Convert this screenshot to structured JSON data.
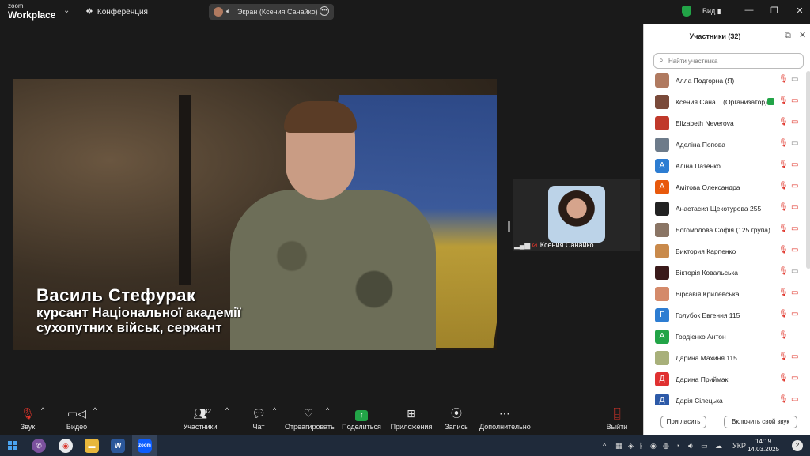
{
  "titlebar": {
    "logo_line1": "zoom",
    "logo_line2": "Workplace",
    "meeting_label": "Конференция",
    "share_indicator": "Экран (Ксения Санайко)",
    "view_label": "Вид"
  },
  "shared_screen": {
    "caption_name": "Василь Стефурак",
    "caption_line1": "курсант Національної академії",
    "caption_line2": "сухопутних військ, сержант"
  },
  "self_view": {
    "name": "Ксения Санайко"
  },
  "toolbar": {
    "audio": "Звук",
    "video": "Видео",
    "participants": "Участники",
    "participants_count": "32",
    "chat": "Чат",
    "react": "Отреагировать",
    "share": "Поделиться",
    "apps": "Приложения",
    "record": "Запись",
    "more": "Дополнительно",
    "leave": "Выйти"
  },
  "participants_panel": {
    "title": "Участники (32)",
    "search_placeholder": "Найти участника",
    "invite_button": "Пригласить",
    "unmute_button": "Включить свой звук",
    "participants": [
      {
        "name": "Алла Подгорна (Я)",
        "avatar": "",
        "avatar_color": "#b07a60",
        "cam": "on"
      },
      {
        "name": "Ксения Сана... (Организатор)",
        "avatar": "",
        "avatar_color": "#7a4a3a",
        "cam": "off",
        "host": true
      },
      {
        "name": "Elizabeth Neverova",
        "avatar": "",
        "avatar_color": "#c0392b",
        "cam": "off"
      },
      {
        "name": "Аделіна Попова",
        "avatar": "",
        "avatar_color": "#6d7b8a",
        "cam": "on"
      },
      {
        "name": "Аліна Пазенко",
        "avatar": "А",
        "avatar_color": "#2d7dd2",
        "cam": "off"
      },
      {
        "name": "Амітова Олександра",
        "avatar": "А",
        "avatar_color": "#e8590c",
        "cam": "off"
      },
      {
        "name": "Анастасия Щекотурова 255",
        "avatar": "",
        "avatar_color": "#222222",
        "cam": "off"
      },
      {
        "name": "Богомолова Софія (125 група)",
        "avatar": "",
        "avatar_color": "#8a7565",
        "cam": "off"
      },
      {
        "name": "Виктория Карпенко",
        "avatar": "",
        "avatar_color": "#c98a4b",
        "cam": "off"
      },
      {
        "name": "Вікторія Ковальська",
        "avatar": "",
        "avatar_color": "#3a1a1a",
        "cam": "on"
      },
      {
        "name": "Вірсавія Крилевська",
        "avatar": "",
        "avatar_color": "#d48a6a",
        "cam": "off"
      },
      {
        "name": "Голубок Евгения 115",
        "avatar": "Г",
        "avatar_color": "#2d7dd2",
        "cam": "off"
      },
      {
        "name": "Гордієнко Антон",
        "avatar": "А",
        "avatar_color": "#22a447",
        "cam": "none"
      },
      {
        "name": "Дарина Махиня 115",
        "avatar": "",
        "avatar_color": "#a8b07a",
        "cam": "off"
      },
      {
        "name": "Дарина Приймак",
        "avatar": "Д",
        "avatar_color": "#e03131",
        "cam": "off"
      },
      {
        "name": "Дарія Сілецька",
        "avatar": "Д",
        "avatar_color": "#2d5aa8",
        "cam": "off"
      }
    ]
  },
  "taskbar": {
    "language": "УКР",
    "time": "14:19",
    "date": "14.03.2025",
    "notifications": "2"
  },
  "colors": {
    "zoom_blue": "#0b5cff",
    "leave_red": "#e0352b",
    "share_green": "#22a447",
    "dark_bg": "#1a1a1a"
  }
}
